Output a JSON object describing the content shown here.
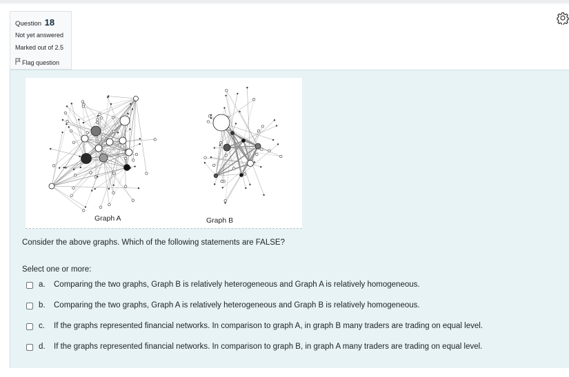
{
  "question": {
    "label": "Question",
    "number": "18",
    "status": "Not yet answered",
    "marks": "Marked out of 2.5",
    "flag_label": "Flag question"
  },
  "figure": {
    "graph_a_label": "Graph A",
    "graph_b_label": "Graph B"
  },
  "question_text": "Consider the above graphs. Which of the following statements are FALSE?",
  "prompt": "Select one or more:",
  "options": [
    {
      "letter": "a.",
      "text": "Comparing the two graphs, Graph B is relatively heterogeneous and Graph A is relatively homogeneous.",
      "checked": false
    },
    {
      "letter": "b.",
      "text": "Comparing the two graphs, Graph A is relatively heterogeneous and Graph B is relatively homogeneous.",
      "checked": false
    },
    {
      "letter": "c.",
      "text": "If the graphs represented financial networks. In comparison to graph A, in graph B many traders are trading on equal level.",
      "checked": false
    },
    {
      "letter": "d.",
      "text": "If the graphs represented financial networks. In comparison to graph B, in graph A many traders are trading on equal level.",
      "checked": false
    }
  ],
  "colors": {
    "content_bg": "#e7f3f5",
    "info_bg": "#f8f9fa",
    "number_color": "#0f2a3f"
  },
  "icons": {
    "flag": "flag-icon",
    "settings": "gear-icon"
  }
}
